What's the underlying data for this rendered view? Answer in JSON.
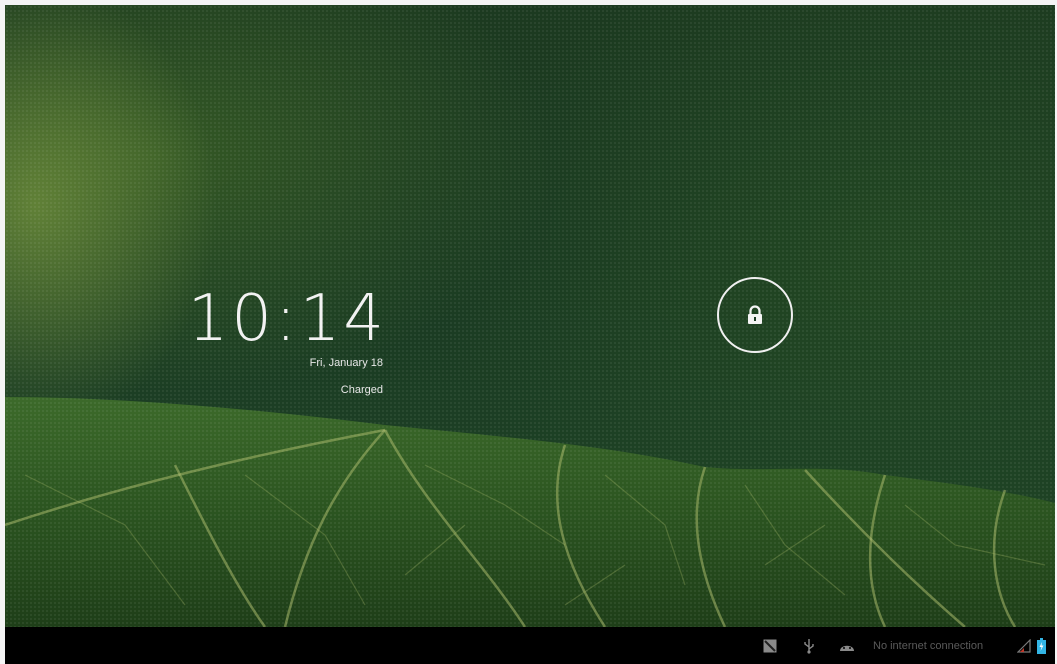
{
  "lockscreen": {
    "time": "10:14",
    "date": "Fri, January 18",
    "battery_status": "Charged"
  },
  "status_bar": {
    "network_status": "No internet connection",
    "icons": [
      "screenshot-icon",
      "usb-icon",
      "android-debug-icon",
      "signal-icon",
      "battery-icon"
    ]
  },
  "colors": {
    "wallpaper_dark": "#1a3a22",
    "wallpaper_light": "#8caa46",
    "text": "#f2f2f2",
    "battery_accent": "#33b5e5"
  }
}
